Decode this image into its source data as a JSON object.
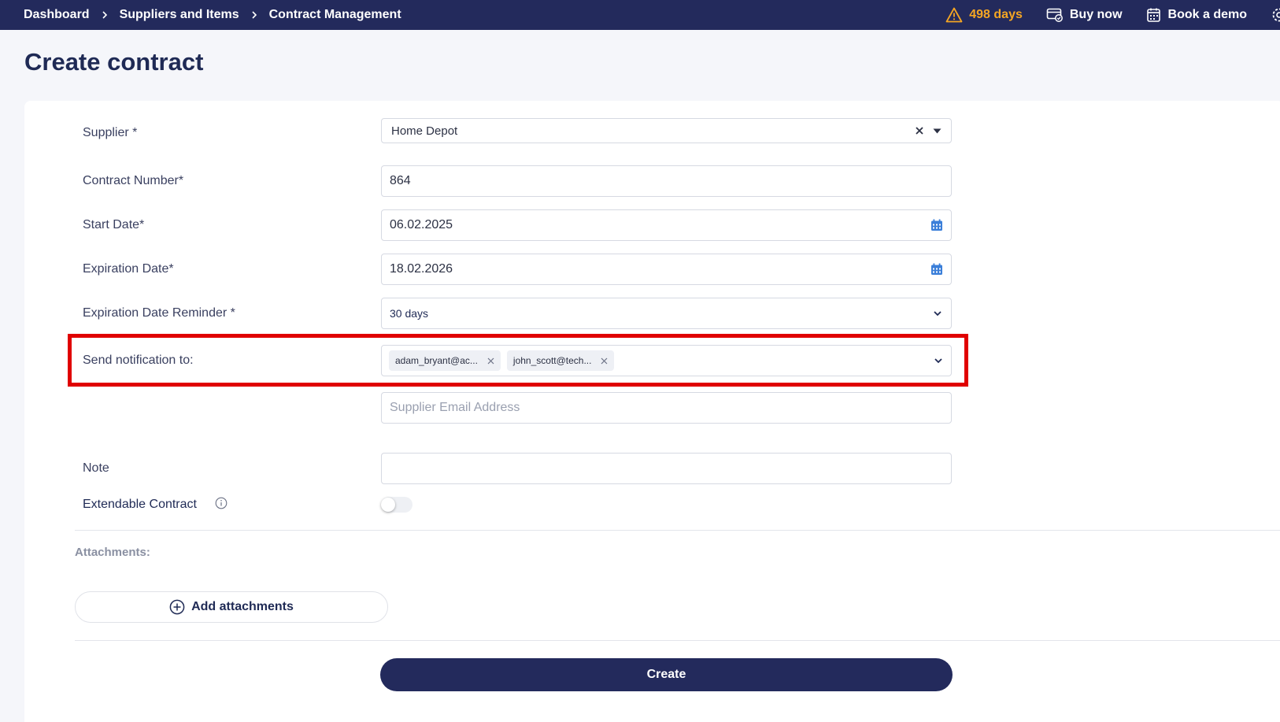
{
  "breadcrumb": {
    "items": [
      "Dashboard",
      "Suppliers and Items",
      "Contract Management"
    ]
  },
  "topbar": {
    "trial_days": "498 days",
    "buy_now": "Buy now",
    "book_demo": "Book a demo",
    "trial_color": "#f5a623"
  },
  "page": {
    "title": "Create contract"
  },
  "form": {
    "supplier": {
      "label": "Supplier *",
      "value": "Home Depot"
    },
    "contract_number": {
      "label": "Contract Number*",
      "value": "864"
    },
    "start_date": {
      "label": "Start Date*",
      "value": "06.02.2025"
    },
    "expiration_date": {
      "label": "Expiration Date*",
      "value": "18.02.2026"
    },
    "reminder": {
      "label": "Expiration Date Reminder *",
      "value": "30 days"
    },
    "notification": {
      "label": "Send notification to:",
      "chips": [
        "adam_bryant@ac...",
        "john_scott@tech..."
      ]
    },
    "supplier_email": {
      "placeholder": "Supplier Email Address",
      "value": ""
    },
    "note": {
      "label": "Note",
      "value": ""
    },
    "extendable": {
      "label": "Extendable Contract",
      "enabled": false
    }
  },
  "attachments": {
    "label": "Attachments:",
    "add_button": "Add attachments"
  },
  "actions": {
    "create": "Create"
  },
  "colors": {
    "nav_bg": "#232a5c",
    "highlight": "#e00000",
    "calendar_icon": "#3b7fd9"
  }
}
